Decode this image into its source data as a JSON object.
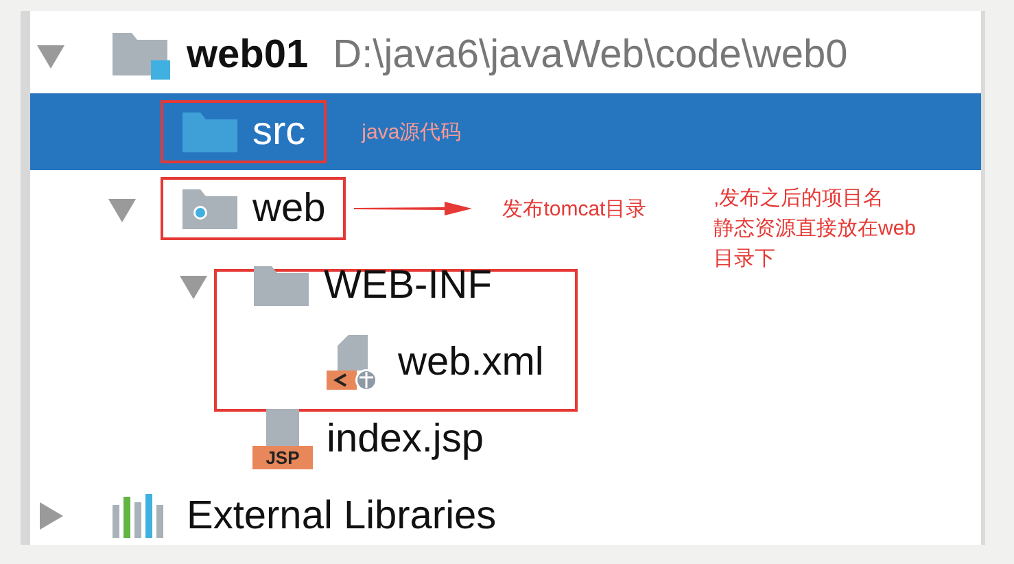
{
  "tree": [
    {
      "kind": "module",
      "label": "web01",
      "path": "D:\\java6\\javaWeb\\code\\web0",
      "expanded": true,
      "selected": false,
      "children": [
        {
          "kind": "source-folder",
          "label": "src",
          "selected": true,
          "framed": true,
          "note": "java源代码"
        },
        {
          "kind": "web-folder",
          "label": "web",
          "expanded": true,
          "selected": false,
          "framed": true,
          "note": "发布tomcat目录",
          "note_arrow": true,
          "comment": [
            ",发布之后的项目名",
            "静态资源直接放在web",
            "目录下"
          ],
          "children": [
            {
              "kind": "folder",
              "label": "WEB-INF",
              "expanded": true,
              "selected": false,
              "framed_group": true,
              "children": [
                {
                  "kind": "xml-file",
                  "label": "web.xml",
                  "selected": false
                }
              ]
            },
            {
              "kind": "jsp-file",
              "label": "index.jsp",
              "badge": "JSP",
              "selected": false
            }
          ]
        }
      ]
    },
    {
      "kind": "libraries",
      "label": "External Libraries",
      "expanded": false,
      "selected": false
    }
  ]
}
